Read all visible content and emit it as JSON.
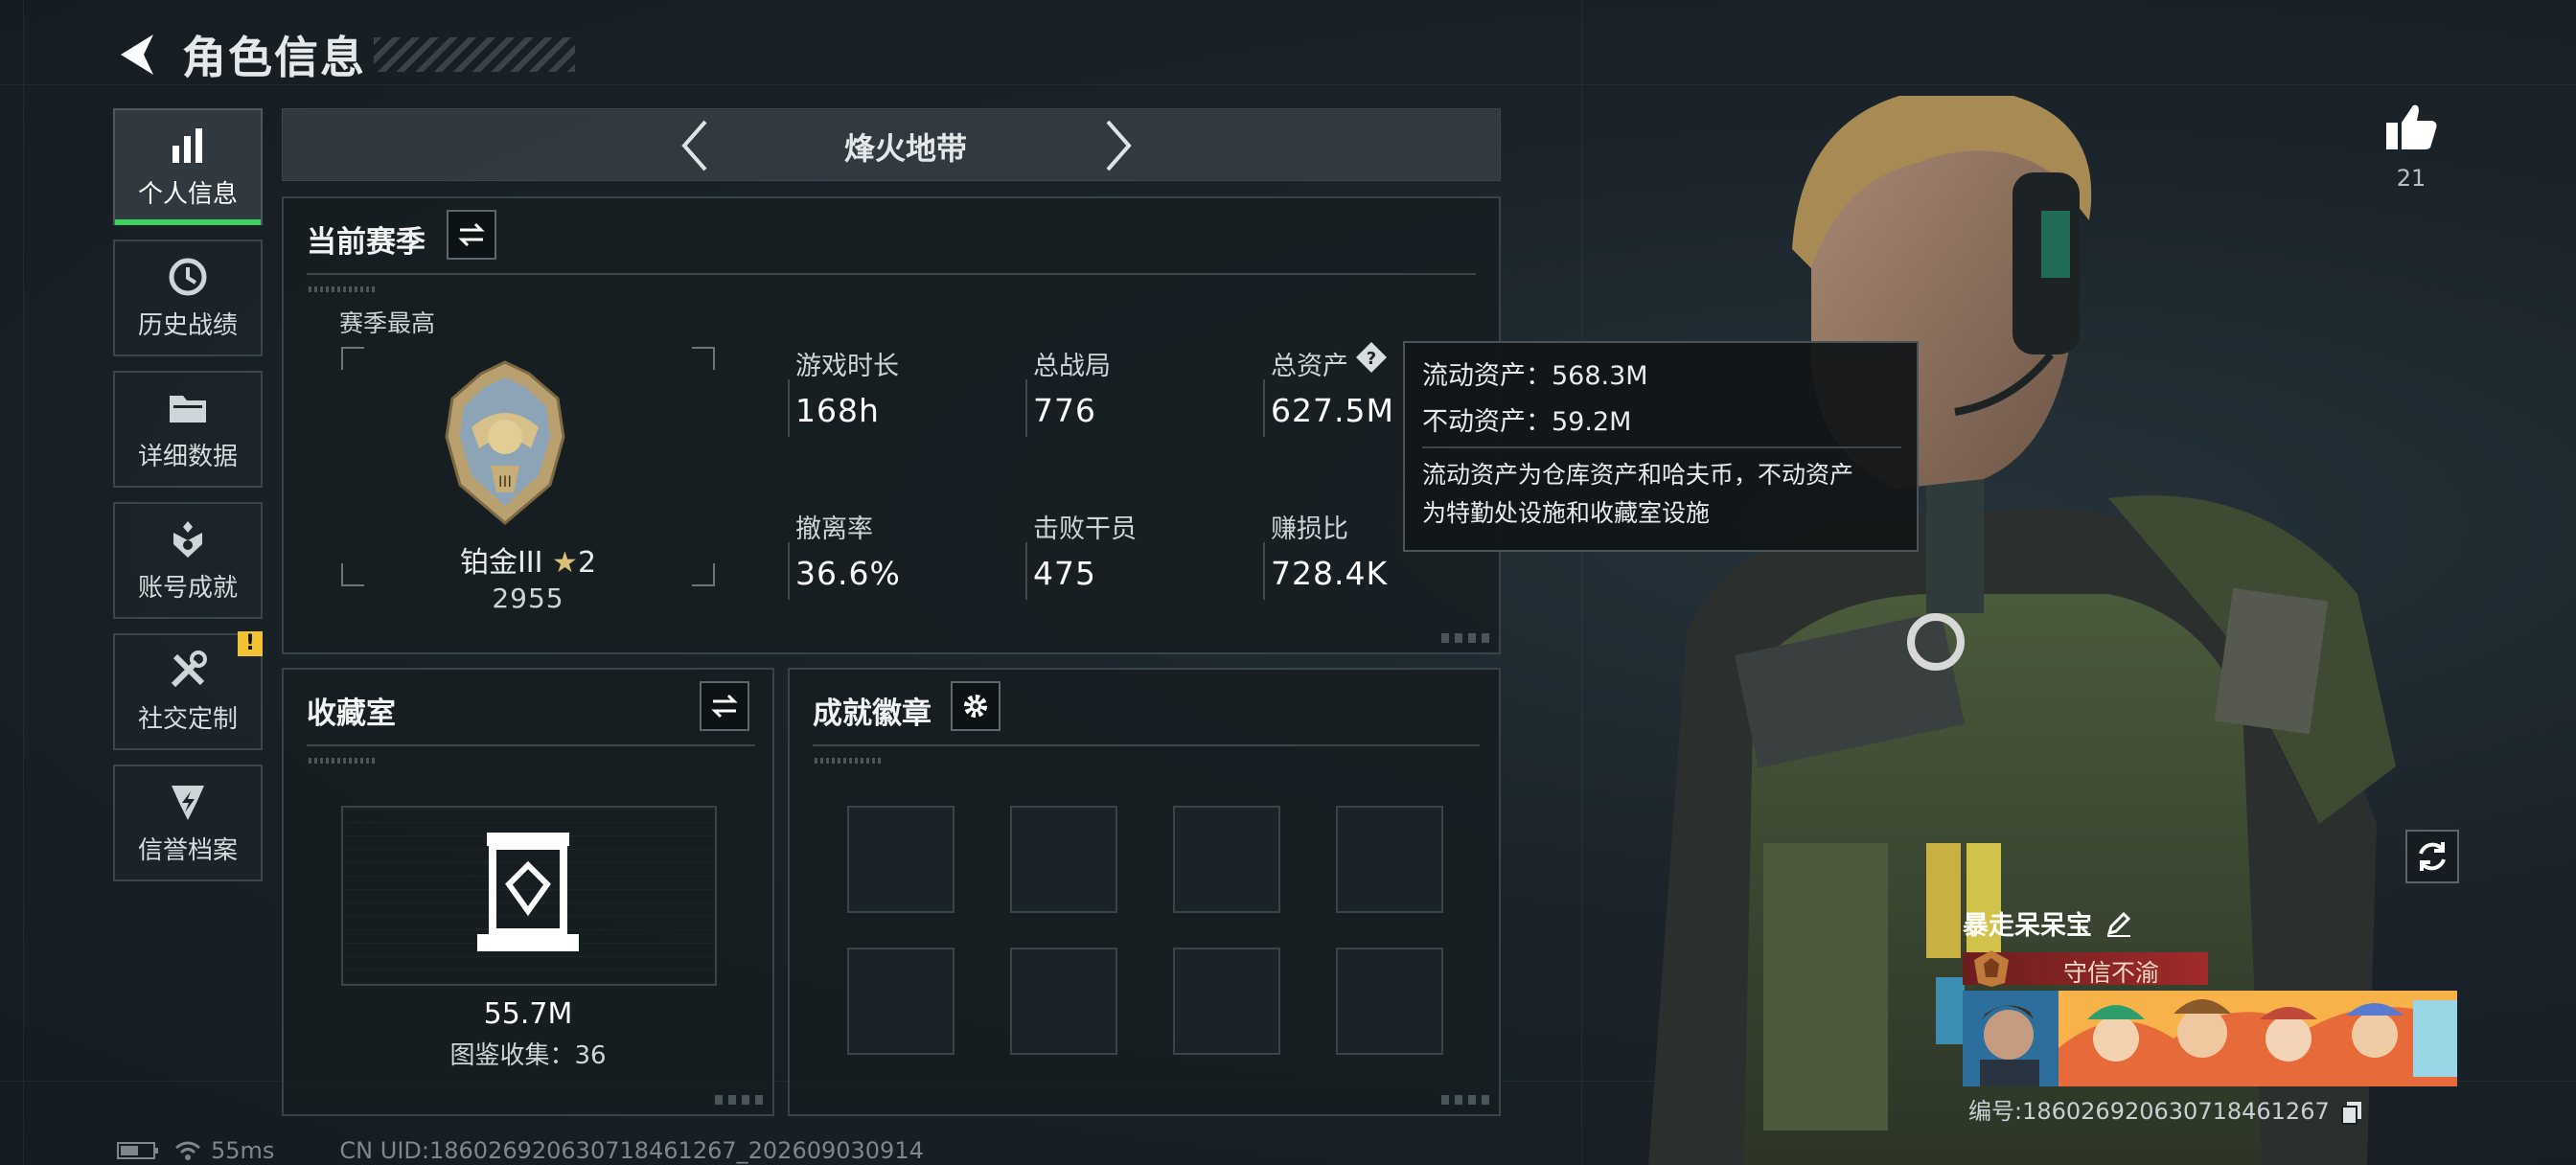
{
  "header": {
    "title": "角色信息"
  },
  "sidebar": {
    "items": [
      {
        "label": "个人信息",
        "icon": "bar-chart-icon",
        "active": true
      },
      {
        "label": "历史战绩",
        "icon": "history-icon"
      },
      {
        "label": "详细数据",
        "icon": "folder-icon"
      },
      {
        "label": "账号成就",
        "icon": "achievement-icon"
      },
      {
        "label": "社交定制",
        "icon": "tools-icon",
        "badge": "!"
      },
      {
        "label": "信誉档案",
        "icon": "credit-shield-icon"
      }
    ]
  },
  "mode": {
    "name": "烽火地带"
  },
  "season": {
    "title": "当前赛季",
    "best_label": "赛季最高",
    "rank_name": "铂金III",
    "rank_stars": "2",
    "rank_score": "2955",
    "stats": [
      {
        "label": "游戏时长",
        "value": "168h"
      },
      {
        "label": "总战局",
        "value": "776"
      },
      {
        "label": "总资产",
        "value": "627.5M"
      },
      {
        "label": "撤离率",
        "value": "36.6%"
      },
      {
        "label": "击败干员",
        "value": "475"
      },
      {
        "label": "赚损比",
        "value": "728.4K"
      }
    ]
  },
  "tooltip": {
    "liquid": "流动资产：568.3M",
    "fixed": "不动资产：59.2M",
    "note_line1": "流动资产为仓库资产和哈夫币，不动资产",
    "note_line2": "为特勤处设施和收藏室设施"
  },
  "collection": {
    "title": "收藏室",
    "value": "55.7M",
    "catalog": "图鉴收集：36"
  },
  "badges": {
    "title": "成就徽章",
    "slots": 8
  },
  "like": {
    "count": "21"
  },
  "player": {
    "name": "暴走呆呆宝",
    "title": "守信不渝",
    "id": "编号:18602692063071846126​7"
  },
  "footer": {
    "ping": "55ms",
    "uid": "CN UID:18602692063071846126​7_202609030914"
  },
  "colors": {
    "accent_green": "#3fd15f",
    "title_red": "#a12a2a",
    "warn_yellow": "#f1c232"
  }
}
